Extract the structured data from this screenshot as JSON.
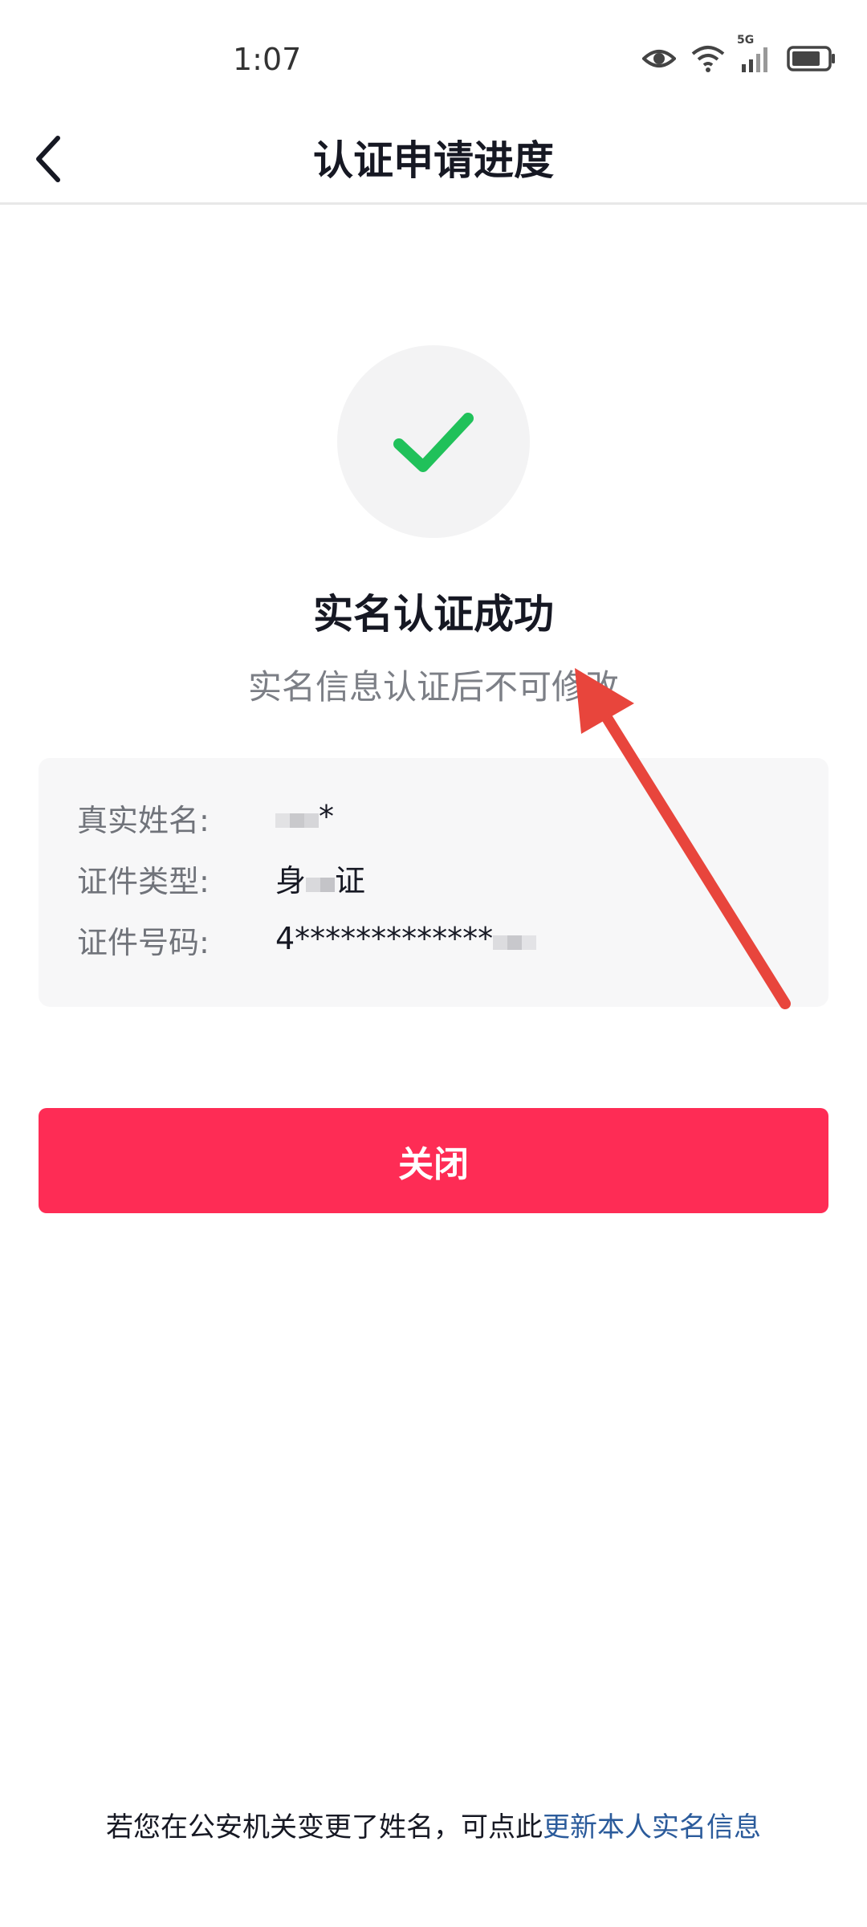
{
  "status_bar": {
    "time": "1:07",
    "network": "5G",
    "icons": [
      "eye-icon",
      "wifi-icon",
      "signal-icon",
      "battery-icon"
    ]
  },
  "nav": {
    "title": "认证申请进度",
    "back_icon": "chevron-left-icon"
  },
  "result": {
    "icon": "check-icon",
    "title": "实名认证成功",
    "subtitle": "实名信息认证后不可修改"
  },
  "info": {
    "name_label": "真实姓名:",
    "name_value_visible": "*",
    "type_label": "证件类型:",
    "type_value_start": "身",
    "type_value_end": "证",
    "number_label": "证件号码:",
    "number_value_visible": "4*************"
  },
  "close_button": {
    "label": "关闭"
  },
  "footer": {
    "text": "若您在公安机关变更了姓名，可点此",
    "link": "更新本人实名信息"
  },
  "colors": {
    "accent": "#fe2c55",
    "success": "#20c15a",
    "link": "#2b5b9b",
    "annotation": "#e8453c"
  }
}
